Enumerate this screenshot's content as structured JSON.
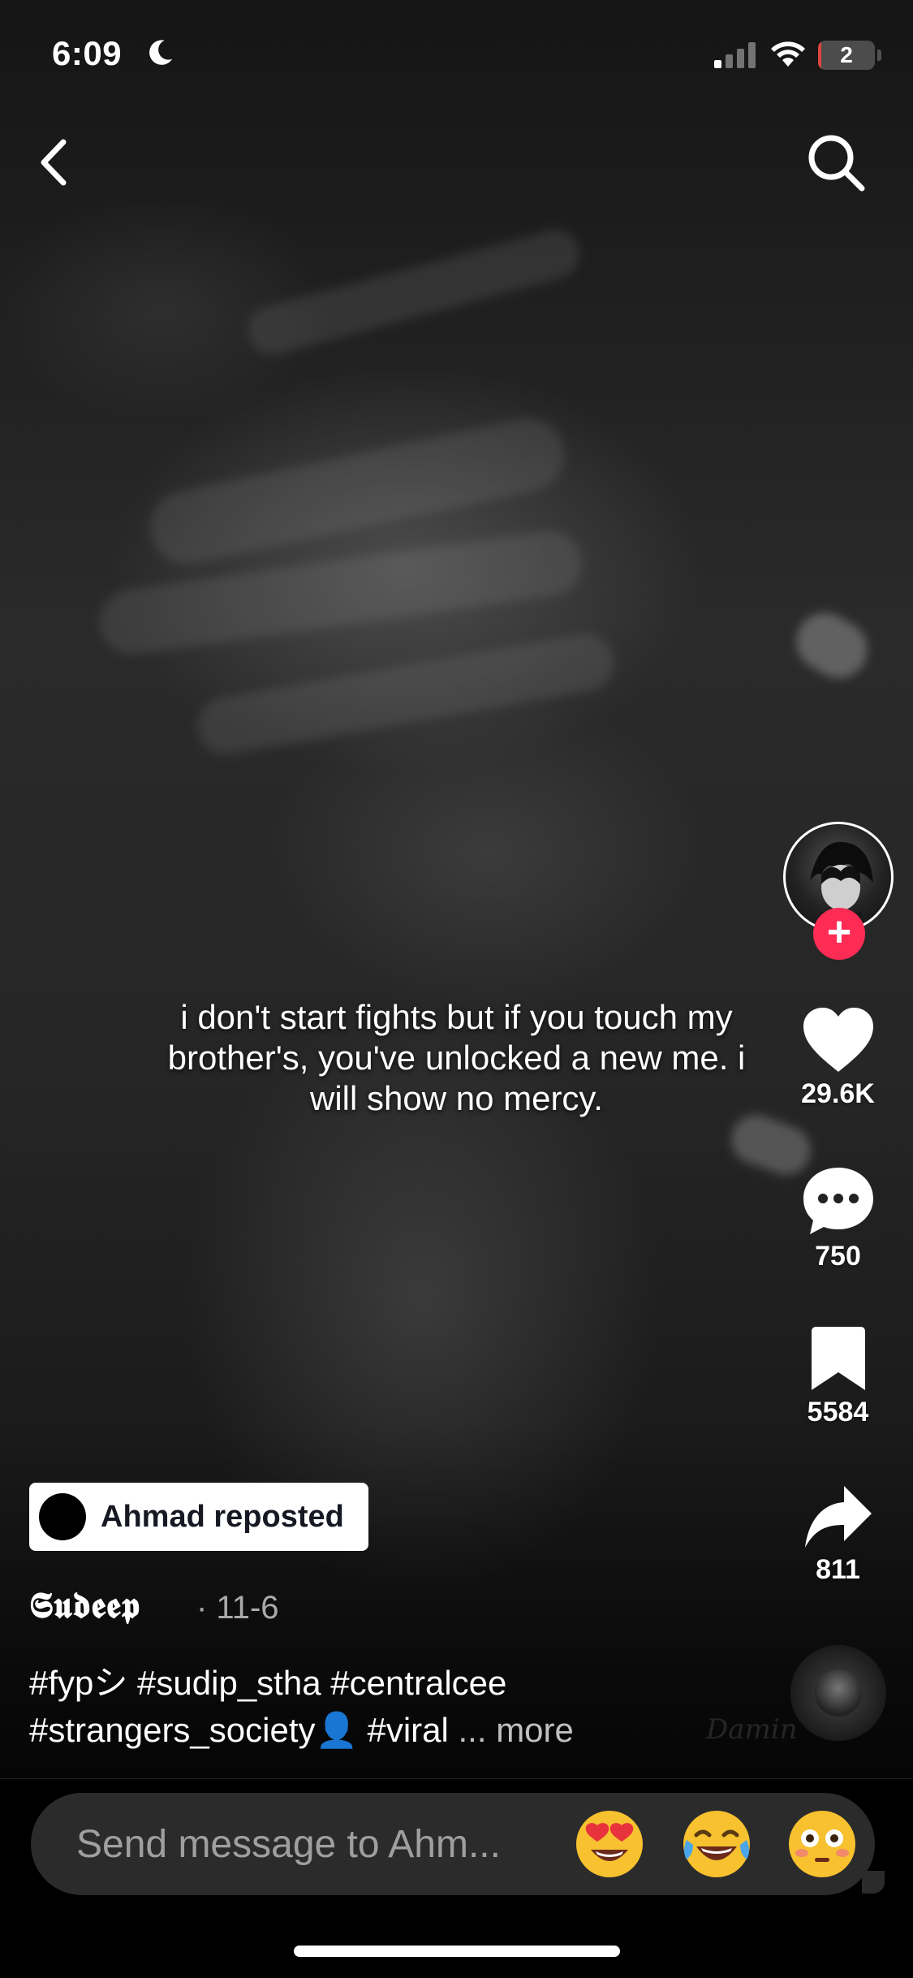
{
  "status_bar": {
    "time": "6:09",
    "battery_level": "2",
    "battery_fraction": 0.05,
    "icons": [
      "moon-icon",
      "cellular-signal-icon",
      "wifi-icon",
      "battery-icon"
    ]
  },
  "nav": {
    "back_icon": "chevron-left-icon",
    "search_icon": "search-icon"
  },
  "video": {
    "overlay_text": "i don't start fights but if you touch my brother's, you've unlocked a new me. i will show no mercy.",
    "watermark": "Damin"
  },
  "rail": {
    "likes": "29.6K",
    "comments": "750",
    "saves": "5584",
    "shares": "811",
    "follow_symbol": "+"
  },
  "repost": {
    "label": "Ahmad reposted"
  },
  "post": {
    "author": "𝕾𝖚𝖉𝖊𝖊𝖕",
    "date": "· 11-6",
    "description": "#fypシ #sudip_stha #centralcee #strangers_society👤 #viral",
    "more": "... more"
  },
  "composer": {
    "placeholder": "Send message to Ahm...",
    "emojis": [
      "heart-eyes-emoji",
      "tears-of-joy-emoji",
      "flushed-emoji"
    ]
  },
  "colors": {
    "accent": "#fe2c55",
    "battery_low": "#e0443e",
    "composer_bg": "#2b2b2b"
  }
}
